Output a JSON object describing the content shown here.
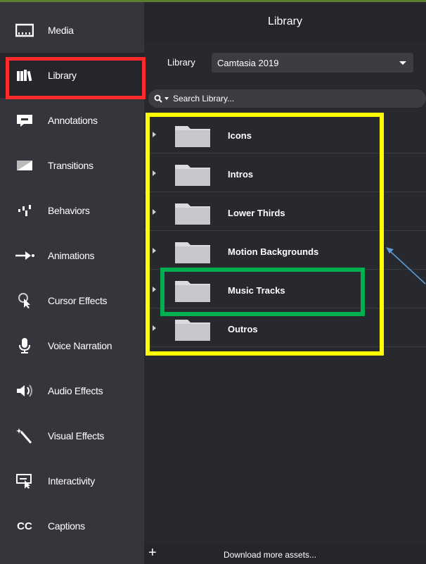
{
  "sidebar": {
    "items": [
      {
        "label": "Media",
        "icon": "media-icon"
      },
      {
        "label": "Library",
        "icon": "library-icon"
      },
      {
        "label": "Annotations",
        "icon": "annotations-icon"
      },
      {
        "label": "Transitions",
        "icon": "transitions-icon"
      },
      {
        "label": "Behaviors",
        "icon": "behaviors-icon"
      },
      {
        "label": "Animations",
        "icon": "animations-icon"
      },
      {
        "label": "Cursor Effects",
        "icon": "cursor-effects-icon"
      },
      {
        "label": "Voice Narration",
        "icon": "microphone-icon"
      },
      {
        "label": "Audio Effects",
        "icon": "speaker-icon"
      },
      {
        "label": "Visual Effects",
        "icon": "magic-wand-icon"
      },
      {
        "label": "Interactivity",
        "icon": "interactivity-icon"
      },
      {
        "label": "Captions",
        "icon": "cc-icon",
        "icon_text": "CC"
      }
    ],
    "active_index": 1
  },
  "main": {
    "title": "Library",
    "library_label": "Library",
    "library_select_value": "Camtasia 2019",
    "search_placeholder": "Search Library...",
    "rows": [
      {
        "label": "Icons"
      },
      {
        "label": "Intros"
      },
      {
        "label": "Lower Thirds"
      },
      {
        "label": "Motion Backgrounds"
      },
      {
        "label": "Music Tracks"
      },
      {
        "label": "Outros"
      }
    ],
    "footer": {
      "add_label": "+",
      "download_label": "Download more assets..."
    }
  },
  "colors": {
    "sidebar_bg": "#34363c",
    "main_bg": "#27292e",
    "highlight_red": "#ff2a2a",
    "highlight_yellow": "#ffff00",
    "highlight_green": "#00b050",
    "arrow": "#5b9bd5"
  }
}
